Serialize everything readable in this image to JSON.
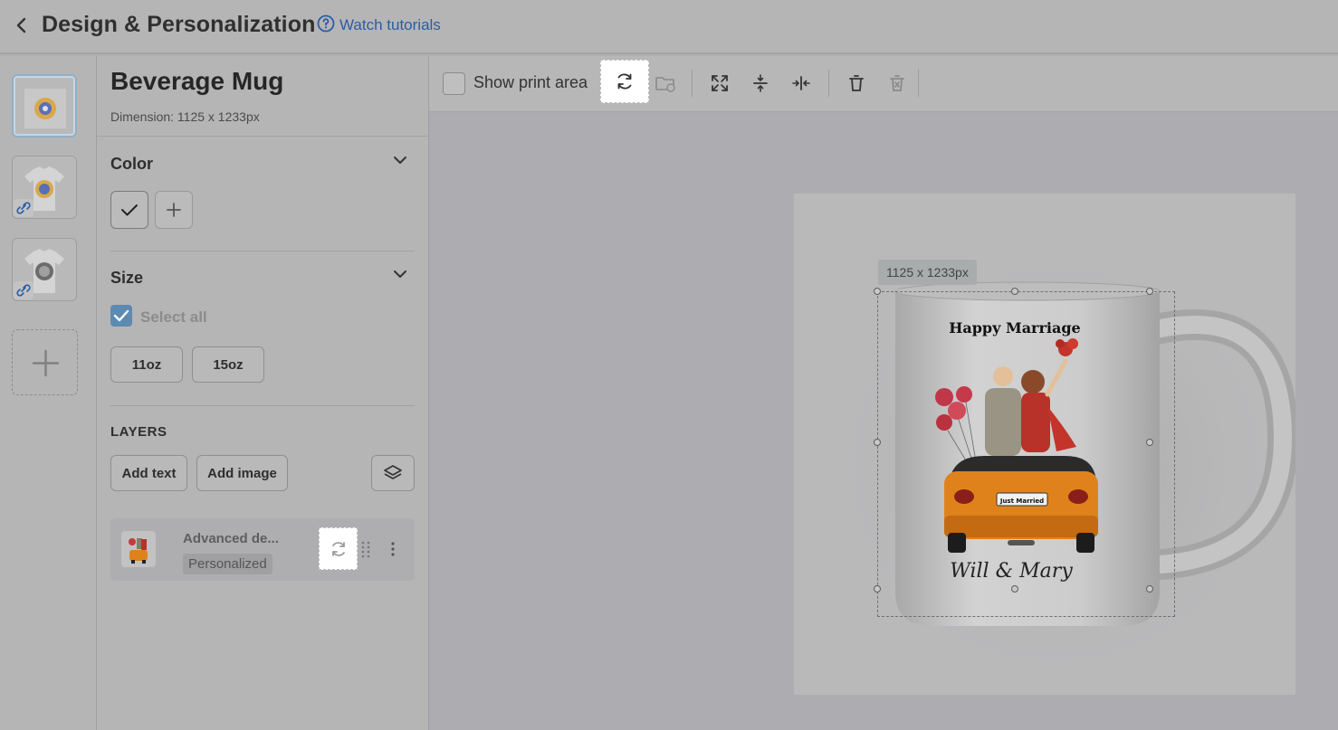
{
  "header": {
    "title": "Design & Personalization",
    "tutorials_link": "Watch tutorials"
  },
  "product": {
    "name": "Beverage Mug",
    "dimension": "Dimension: 1125 x 1233px"
  },
  "sections": {
    "color": "Color",
    "size": "Size",
    "select_all": "Select all",
    "sizes": [
      "11oz",
      "15oz"
    ],
    "layers": "LAYERS",
    "add_text": "Add text",
    "add_image": "Add image"
  },
  "layer": {
    "name": "Advanced de...",
    "badge": "Personalized"
  },
  "toolbar": {
    "show_print_area": "Show print area"
  },
  "canvas": {
    "dimension_tag": "1125 x 1233px",
    "mug_top_text": "Happy Marriage",
    "plate_text": "Just Married",
    "mug_bottom_text": "Will & Mary"
  },
  "colors": {
    "accent": "#2a5da3",
    "checkbox": "#5c8ab0",
    "car": "#e0821c"
  }
}
